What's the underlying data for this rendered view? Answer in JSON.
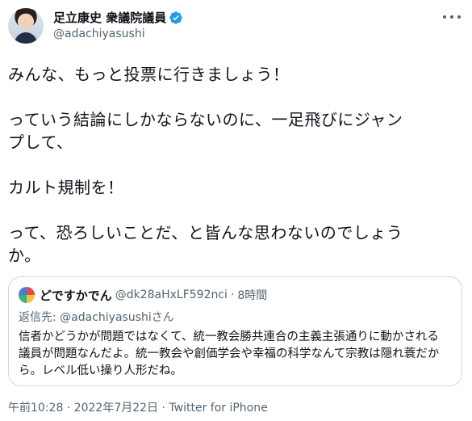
{
  "author": {
    "display_name": "足立康史 衆議院議員",
    "handle": "@adachiyasushi",
    "verified_icon": "verified-badge-icon",
    "verified_color": "#1d9bf0"
  },
  "tweet": {
    "paragraphs": [
      "みんな、もっと投票に行きましょう！",
      "っていう結論にしかならないのに、一足飛びにジャン\nプして、",
      "カルト規制を！",
      "って、恐ろしいことだ、と皆んな思わないのでしょう\nか。"
    ]
  },
  "quote": {
    "display_name": "どですかでん",
    "handle": "@dk28aHxLF592nci",
    "separator": "·",
    "time": "8時間",
    "reply_to": "返信先: @adachiyasushiさん",
    "lines": [
      "信者かどうかが問題ではなくて、統一教会勝共連合の主義主張通りに動かされる",
      "議員が問題なんだよ。統一教会や創価学会や幸福の科学なんて宗教は隠れ蓑だか",
      "ら。レベル低い操り人形だね。"
    ]
  },
  "footer": {
    "timestamp": "午前10:28 · 2022年7月22日 · Twitter for iPhone"
  },
  "colors": {
    "text": "#0f1419",
    "secondary": "#536471",
    "border": "#cfd9de",
    "accent": "#1d9bf0"
  }
}
